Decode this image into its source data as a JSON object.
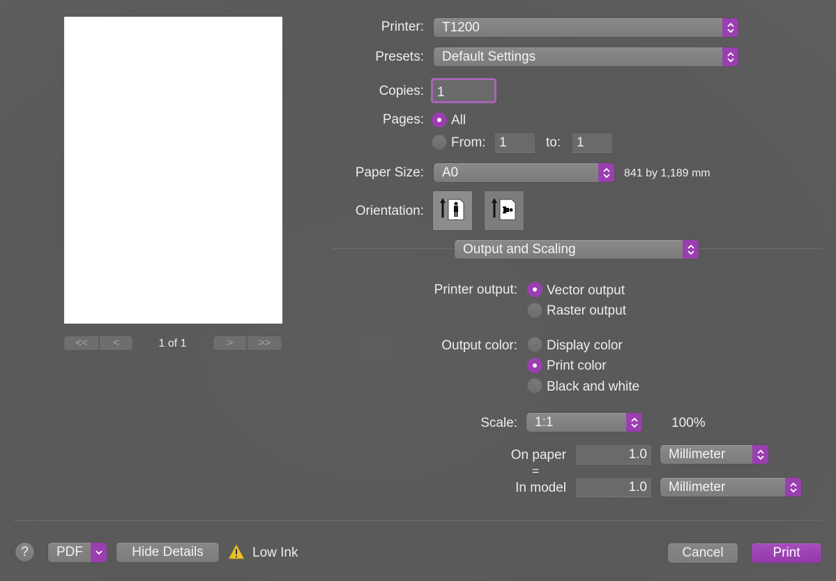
{
  "preview": {
    "page_indicator": "1 of 1",
    "nav_first": "<<",
    "nav_prev": "<",
    "nav_next": ">",
    "nav_last": ">>"
  },
  "printer": {
    "label": "Printer:",
    "value": "T1200"
  },
  "presets": {
    "label": "Presets:",
    "value": "Default Settings"
  },
  "copies": {
    "label": "Copies:",
    "value": "1"
  },
  "pages": {
    "label": "Pages:",
    "all_label": "All",
    "from_label": "From:",
    "from_value": "1",
    "to_label": "to:",
    "to_value": "1",
    "selected": "All"
  },
  "paper_size": {
    "label": "Paper Size:",
    "value": "A0",
    "dimensions": "841 by 1,189 mm"
  },
  "orientation": {
    "label": "Orientation:",
    "selected": "portrait",
    "icons": [
      "portrait-icon",
      "landscape-icon"
    ]
  },
  "section_popup": {
    "value": "Output and Scaling"
  },
  "printer_output": {
    "label": "Printer output:",
    "options": [
      "Vector output",
      "Raster output"
    ],
    "selected": "Vector output"
  },
  "output_color": {
    "label": "Output color:",
    "options": [
      "Display color",
      "Print color",
      "Black and white"
    ],
    "selected": "Print color"
  },
  "scale": {
    "label": "Scale:",
    "value": "1:1",
    "percent": "100%"
  },
  "on_paper": {
    "label": "On paper",
    "value": "1.0",
    "unit": "Millimeter"
  },
  "equals": "=",
  "in_model": {
    "label": "In model",
    "value": "1.0",
    "unit": "Millimeter"
  },
  "footer": {
    "help": "?",
    "pdf": "PDF",
    "hide_details": "Hide Details",
    "warning": "Low Ink",
    "cancel": "Cancel",
    "print": "Print"
  },
  "colors": {
    "accent": "#9a3fb0",
    "background": "#5a5a5a",
    "warning": "#e8c230"
  }
}
